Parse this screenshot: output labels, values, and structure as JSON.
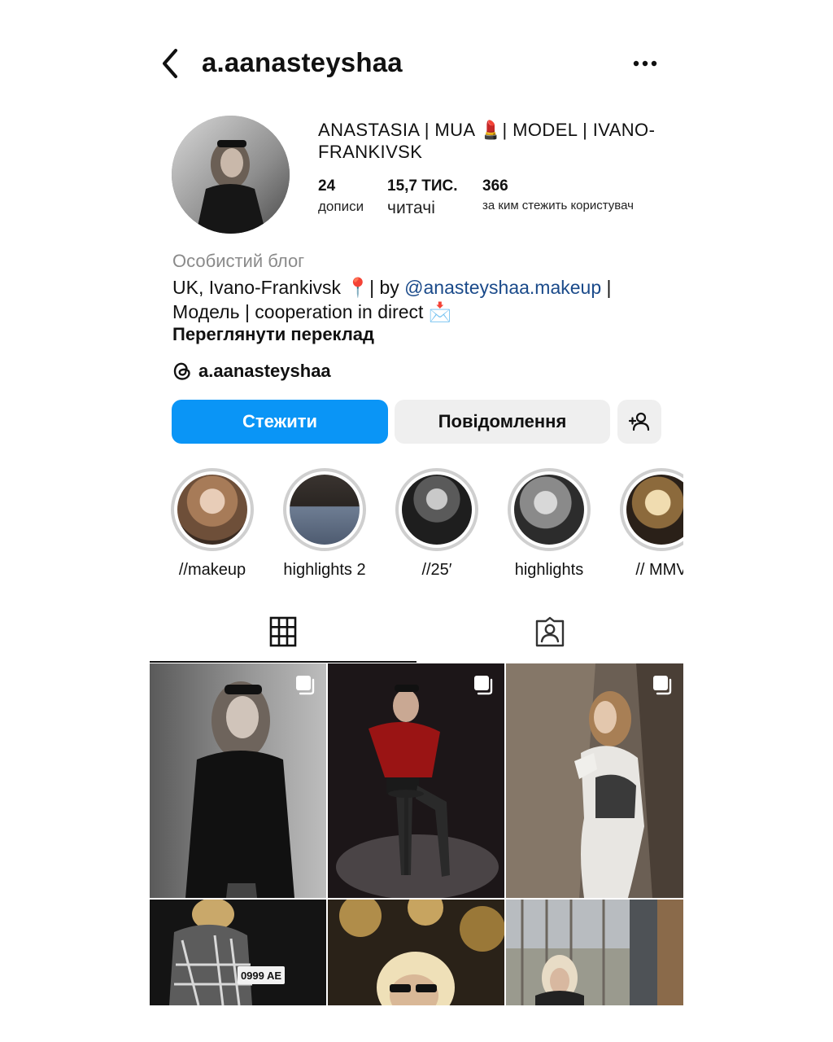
{
  "header": {
    "username": "a.aanasteyshaa"
  },
  "profile": {
    "display_name": "ANASTASIA | MUA 💄|  MODEL | IVANO-FRANKIVSK",
    "stats": [
      {
        "value": "24",
        "label": "дописи"
      },
      {
        "value": "15,7 ТИС.",
        "label": "читачі"
      },
      {
        "value": "366",
        "label": "за ким стежить користувач"
      }
    ],
    "category": "Особистий блог",
    "bio_line1_prefix": "UK, Ivano-Frankivsk 📍| by ",
    "bio_mention": "@anasteyshaa.makeup",
    "bio_line1_suffix": " |",
    "bio_line2": "Модель | cooperation in direct 📩",
    "translate_link": "Переглянути переклад",
    "threads_handle": "a.aanasteyshaa"
  },
  "actions": {
    "follow": "Стежити",
    "message": "Повідомлення"
  },
  "highlights": [
    {
      "label": "//makeup"
    },
    {
      "label": "highlights 2"
    },
    {
      "label": "//25′"
    },
    {
      "label": "highlights"
    },
    {
      "label": "// MMV"
    }
  ],
  "icons": {
    "back": "chevron-left-icon",
    "more": "more-horizontal-icon",
    "threads": "threads-icon",
    "add_user": "add-user-icon",
    "grid": "grid-icon",
    "tagged": "tagged-icon",
    "multi": "multiple-posts-icon"
  },
  "colors": {
    "primary": "#0a95f6",
    "secondary_bg": "#efefef",
    "muted_text": "#8a8a8a",
    "mention": "#1a4a8a"
  },
  "plate_text": "0999 AE"
}
